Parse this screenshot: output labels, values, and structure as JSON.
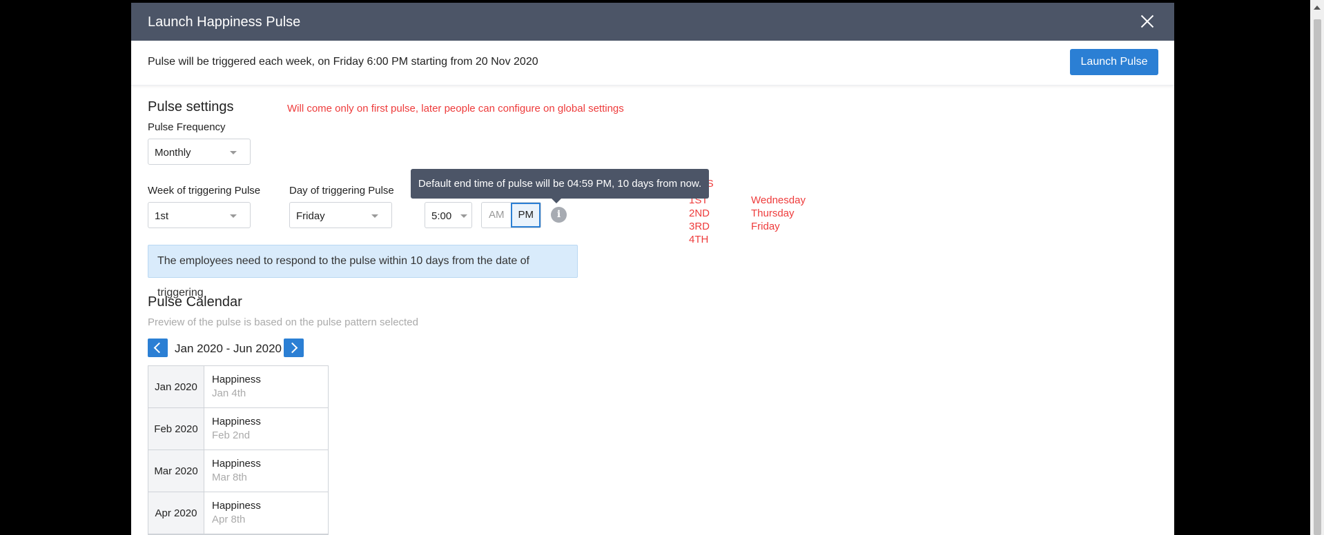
{
  "modal": {
    "title": "Launch Happiness Pulse",
    "info_text": "Pulse will be triggered each week, on Friday 6:00 PM starting from 20  Nov 2020",
    "launch_label": "Launch Pulse"
  },
  "settings": {
    "title": "Pulse settings",
    "note": "Will come only on first pulse, later people can configure on global settings",
    "frequency_label": "Pulse Frequency",
    "frequency_value": "Monthly",
    "week_label": "Week of triggering Pulse",
    "week_value": "1st",
    "day_label": "Day of triggering Pulse",
    "day_value": "Friday",
    "time_value": "5:00",
    "am_label": "AM",
    "pm_label": "PM",
    "selected_period": "PM",
    "tooltip": "Default end time of pulse will be 04:59 PM, 10 days from now.",
    "info_icon": "i",
    "notice": "The employees need to respond to the pulse within 10 days from the date of triggering"
  },
  "options_note": {
    "header": "IONS",
    "weeks": [
      "1ST",
      "2ND",
      "3RD",
      "4TH"
    ],
    "days": [
      "Wednesday",
      "Thursday",
      "Friday"
    ]
  },
  "calendar": {
    "title": "Pulse Calendar",
    "subtitle": "Preview of the pulse is based on the pulse pattern selected",
    "range": "Jan 2020 - Jun 2020",
    "rows": [
      {
        "month": "Jan 2020",
        "name": "Happiness",
        "date": "Jan 4th"
      },
      {
        "month": "Feb 2020",
        "name": "Happiness",
        "date": "Feb 2nd"
      },
      {
        "month": "Mar 2020",
        "name": "Happiness",
        "date": "Mar 8th"
      },
      {
        "month": "Apr 2020",
        "name": "Happiness",
        "date": "Apr 8th"
      }
    ]
  },
  "colors": {
    "header": "#4c5567",
    "accent": "#2b7fd4",
    "warning_text": "#ee3b3b",
    "notice_bg": "#d9ebfb"
  }
}
